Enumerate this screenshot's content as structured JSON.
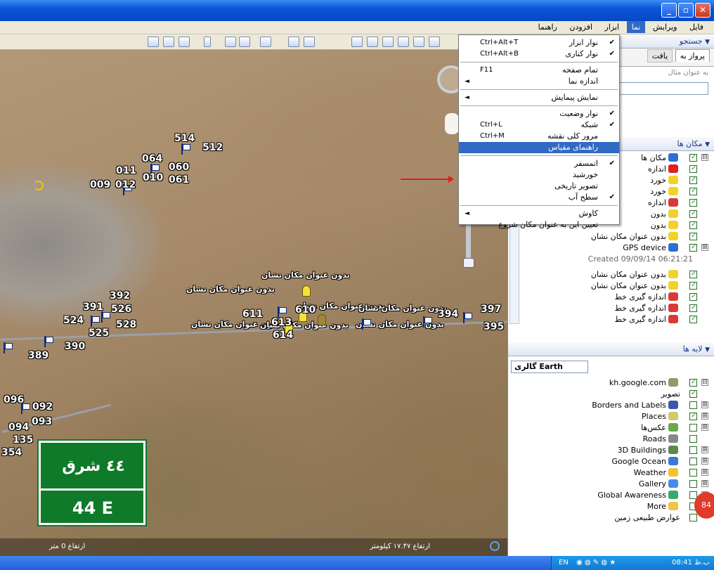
{
  "menubar": [
    "فایل",
    "ویرایش",
    "نما",
    "ابزار",
    "افزودن",
    "راهنما"
  ],
  "view_menu": {
    "items": [
      {
        "label": "نوار ابزار",
        "shortcut": "Ctrl+Alt+T",
        "checked": true
      },
      {
        "label": "نوار کناری",
        "shortcut": "Ctrl+Alt+B",
        "checked": true
      },
      {
        "sep": true
      },
      {
        "label": "تمام صفحه",
        "shortcut": "F11"
      },
      {
        "label": "اندازه نما",
        "submenu": true
      },
      {
        "sep": true
      },
      {
        "label": "نمایش پیمایش",
        "submenu": true
      },
      {
        "sep": true
      },
      {
        "label": "نوار وضعیت",
        "checked": true
      },
      {
        "label": "شبکه",
        "shortcut": "Ctrl+L",
        "checked": true
      },
      {
        "label": "مرور کلی نقشه",
        "shortcut": "Ctrl+M"
      },
      {
        "label": "راهنمای مقیاس",
        "highlighted": true
      },
      {
        "sep": true
      },
      {
        "label": "اتمسفر",
        "checked": true
      },
      {
        "label": "خورشید"
      },
      {
        "label": "تصویر تاریخی"
      },
      {
        "label": "سطح آب",
        "checked": true
      },
      {
        "sep": true
      },
      {
        "label": "کاوش",
        "submenu": true
      },
      {
        "label": "تعیین این به عنوان مکان شروع"
      }
    ]
  },
  "sidebar": {
    "search_header": "جستجو",
    "tab_fly": "پرواز به",
    "tab_find": "یافت",
    "search_hint": "به عنوان مثال",
    "places_header": "مکان ها",
    "places": [
      {
        "label": "مکان ها",
        "icon": "globe-icon",
        "checked": true
      },
      {
        "label": "اندازه",
        "icon": "red-shape-icon",
        "checked": true
      },
      {
        "label": "خورد",
        "icon": "pin-icon",
        "checked": true
      },
      {
        "label": "خورد",
        "icon": "pin-icon",
        "checked": true
      },
      {
        "label": "اندازه",
        "icon": "path-icon",
        "checked": true
      },
      {
        "label": "بدون",
        "icon": "pin-icon",
        "checked": true
      },
      {
        "label": "بدون",
        "icon": "pin-icon",
        "checked": true
      },
      {
        "label": "بدون عنوان مکان نشان",
        "icon": "pin-icon",
        "checked": true
      },
      {
        "label": "GPS device",
        "icon": "globe-icon",
        "checked": true
      }
    ],
    "created": "Created 09/09/14 06:21:21",
    "places2": [
      {
        "label": "بدون عنوان مکان نشان",
        "icon": "pin-icon"
      },
      {
        "label": "بدون عنوان مکان نشان",
        "icon": "pin-icon"
      },
      {
        "label": "اندازه گیری خط",
        "icon": "path-icon"
      },
      {
        "label": "اندازه گیری خط",
        "icon": "path-icon"
      },
      {
        "label": "اندازه گیری خط",
        "icon": "path-icon"
      }
    ],
    "layers_header": "لایه ها",
    "gallery_label": "گالری Earth",
    "layers": [
      {
        "label": "kh.google.com",
        "icon": "globe-icon",
        "checked": true
      },
      {
        "label": "تصویر",
        "checked": true
      },
      {
        "label": "Borders and Labels",
        "icon": "flag-icon",
        "checked": false
      },
      {
        "label": "Places",
        "icon": "places-icon",
        "checked": true
      },
      {
        "label": "عکس‌ها",
        "icon": "photo-icon",
        "checked": false
      },
      {
        "label": "Roads",
        "icon": "road-icon",
        "checked": false
      },
      {
        "label": "3D Buildings",
        "icon": "building-icon",
        "checked": false
      },
      {
        "label": "Google Ocean",
        "icon": "ocean-icon",
        "checked": false
      },
      {
        "label": "Weather",
        "icon": "sun-icon",
        "checked": false
      },
      {
        "label": "Gallery",
        "icon": "star-icon",
        "checked": false
      },
      {
        "label": "Global Awareness",
        "icon": "globe-icon",
        "checked": false
      },
      {
        "label": "More",
        "icon": "folder-icon",
        "checked": false
      },
      {
        "label": "عوارض طبیعی زمین",
        "checked": false
      }
    ]
  },
  "map": {
    "labels_numbers": [
      "514",
      "512",
      "064",
      "060",
      "011",
      "010",
      "061",
      "009",
      "012",
      "392",
      "391",
      "526",
      "524",
      "528",
      "525",
      "611",
      "610",
      "613",
      "614",
      "394",
      "397",
      "395",
      "390",
      "389",
      "096",
      "092",
      "093",
      "094",
      "135",
      "354"
    ],
    "placemark_label": "بدون عنوان مکان نشان",
    "sign_top": "٤٤ شرق",
    "sign_bottom": "44 E",
    "status_left": "ارتفاع 0 متر",
    "status_right": "ارتفاع ۱۷.۴۷ کیلومتر"
  },
  "taskbar": {
    "lang": "EN",
    "time": "08:41 ب.ظ"
  },
  "badge": "84"
}
